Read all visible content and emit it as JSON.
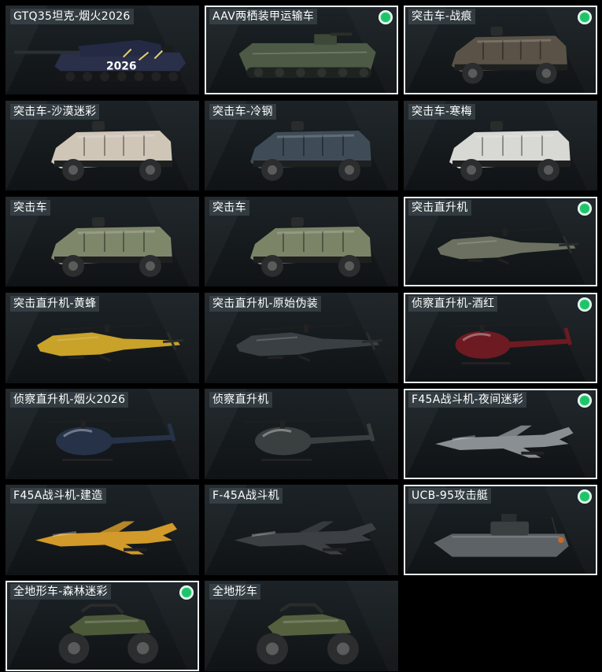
{
  "cards": [
    {
      "label": "GTQ35坦克-烟火2026",
      "selected": false,
      "equipped": false,
      "kind": "tank",
      "tint": "#2a2f4a",
      "decal": "2026"
    },
    {
      "label": "AAV两栖装甲运输车",
      "selected": true,
      "equipped": true,
      "kind": "aav",
      "tint": "#4d5a45",
      "decal": ""
    },
    {
      "label": "突击车-战痕",
      "selected": true,
      "equipped": true,
      "kind": "truck",
      "tint": "#5a5246",
      "decal": ""
    },
    {
      "label": "突击车-沙漠迷彩",
      "selected": false,
      "equipped": false,
      "kind": "truck",
      "tint": "#cfc6b8",
      "decal": ""
    },
    {
      "label": "突击车-冷钢",
      "selected": false,
      "equipped": false,
      "kind": "truck",
      "tint": "#3f4c58",
      "decal": ""
    },
    {
      "label": "突击车-寒梅",
      "selected": false,
      "equipped": false,
      "kind": "truck",
      "tint": "#d8d8d4",
      "decal": ""
    },
    {
      "label": "突击车",
      "selected": false,
      "equipped": false,
      "kind": "truck",
      "tint": "#7f876b",
      "decal": ""
    },
    {
      "label": "突击车",
      "selected": false,
      "equipped": false,
      "kind": "truck",
      "tint": "#7c8468",
      "decal": ""
    },
    {
      "label": "突击直升机",
      "selected": true,
      "equipped": true,
      "kind": "apache",
      "tint": "#6b7060",
      "decal": ""
    },
    {
      "label": "突击直升机-黄蜂",
      "selected": false,
      "equipped": false,
      "kind": "apache",
      "tint": "#c9a22a",
      "decal": ""
    },
    {
      "label": "突击直升机-原始伪装",
      "selected": false,
      "equipped": false,
      "kind": "apache",
      "tint": "#3a3f44",
      "decal": ""
    },
    {
      "label": "侦察直升机-酒红",
      "selected": true,
      "equipped": true,
      "kind": "little",
      "tint": "#6e1a22",
      "decal": ""
    },
    {
      "label": "侦察直升机-烟火2026",
      "selected": false,
      "equipped": false,
      "kind": "little",
      "tint": "#253248",
      "decal": ""
    },
    {
      "label": "侦察直升机",
      "selected": false,
      "equipped": false,
      "kind": "little",
      "tint": "#3a3f40",
      "decal": ""
    },
    {
      "label": "F45A战斗机-夜间迷彩",
      "selected": true,
      "equipped": true,
      "kind": "jet",
      "tint": "#8a8f94",
      "decal": ""
    },
    {
      "label": "F45A战斗机-建造",
      "selected": false,
      "equipped": false,
      "kind": "jet",
      "tint": "#d19a2a",
      "decal": ""
    },
    {
      "label": "F-45A战斗机",
      "selected": false,
      "equipped": false,
      "kind": "jet",
      "tint": "#3c4044",
      "decal": ""
    },
    {
      "label": "UCB-95攻击艇",
      "selected": true,
      "equipped": true,
      "kind": "boat",
      "tint": "#5c6266",
      "decal": ""
    },
    {
      "label": "全地形车-森林迷彩",
      "selected": true,
      "equipped": true,
      "kind": "atv",
      "tint": "#4d5a3a",
      "decal": ""
    },
    {
      "label": "全地形车",
      "selected": false,
      "equipped": false,
      "kind": "atv",
      "tint": "#55603e",
      "decal": ""
    }
  ],
  "colors": {
    "equipped": "#1ec46a",
    "selection_border": "#e9eef0",
    "background": "#000000"
  }
}
